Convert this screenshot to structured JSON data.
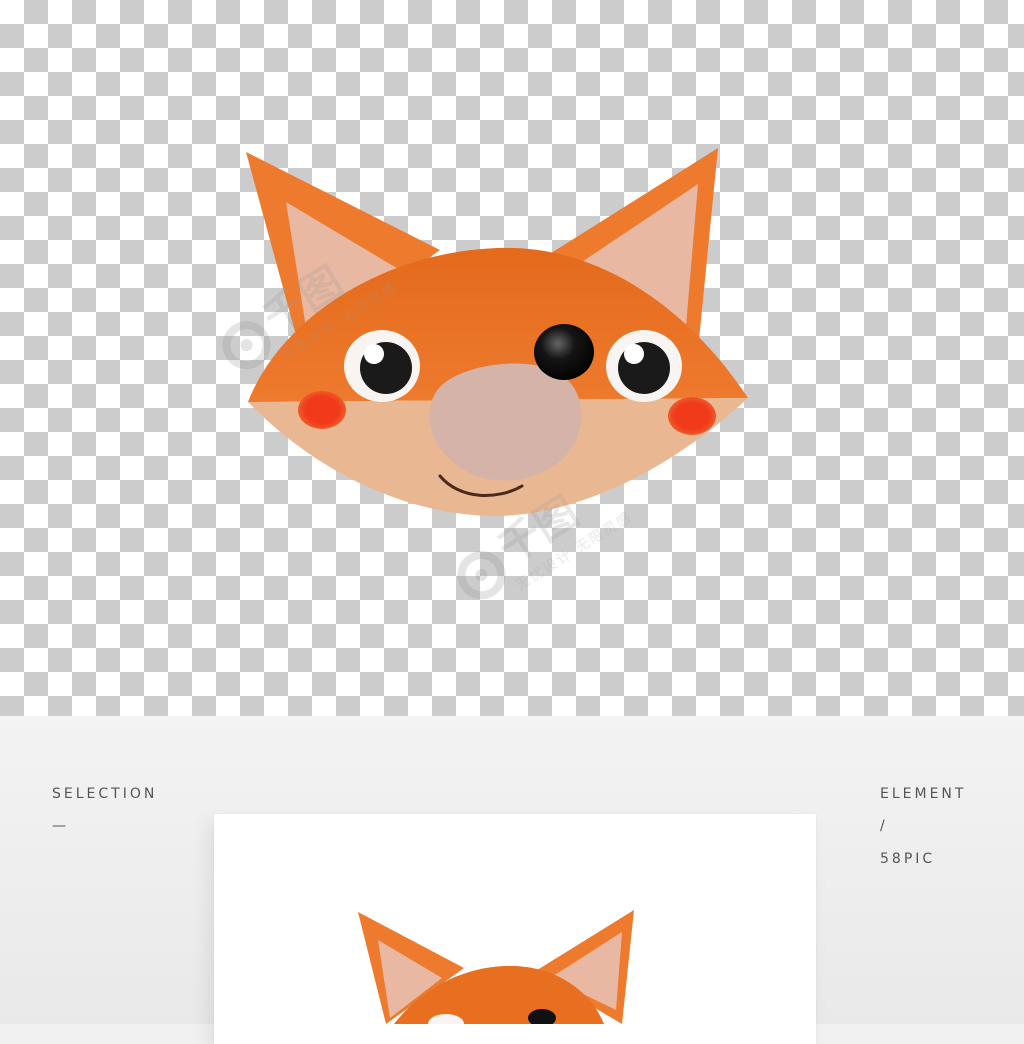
{
  "preview": {
    "caption_left": "SELECTION",
    "caption_left_dash": "—",
    "caption_right": "ELEMENT",
    "caption_right_slash": "/",
    "caption_right_brand": "58PIC"
  },
  "watermark": {
    "logo_text": "千图",
    "slogan": "无忧设计 无限灵感"
  },
  "colors": {
    "fox_orange": "#ee7a2d",
    "fox_head_dark": "#e86f1f",
    "inner_ear": "#e8b8a2",
    "muzzle": "#e9b892",
    "snout": "#d6b3a8",
    "cheek": "#f0391a",
    "eye_white": "#ffffff",
    "pupil": "#1a1a1a",
    "nose": "#111111"
  }
}
